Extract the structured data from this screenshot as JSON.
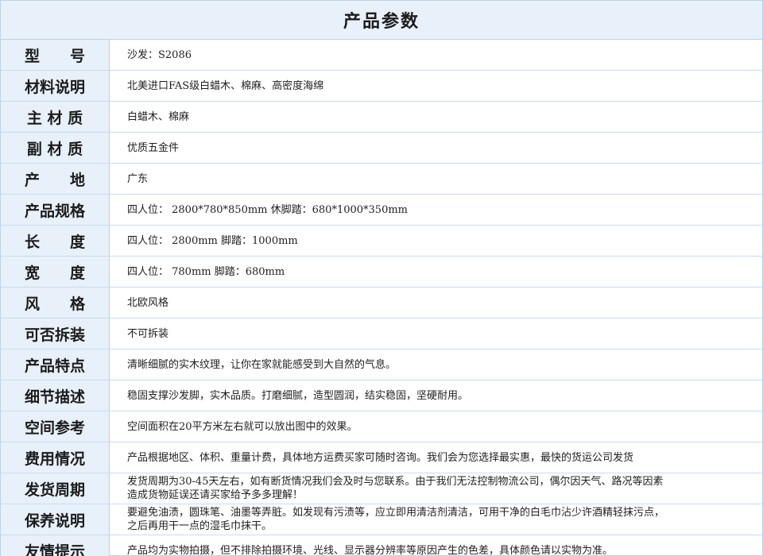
{
  "title": "产品参数",
  "rows": [
    {
      "label": "型　　号",
      "value": "沙发：S2086"
    },
    {
      "label": "材料说明",
      "value": "北美进口FAS级白蜡木、棉麻、高密度海绵"
    },
    {
      "label": "主 材 质",
      "value": "白蜡木、棉麻"
    },
    {
      "label": "副 材 质",
      "value": "优质五金件"
    },
    {
      "label": "产　　地",
      "value": "广东"
    },
    {
      "label": "产品规格",
      "value": "四人位： 2800*780*850mm  休脚踏：680*1000*350mm"
    },
    {
      "label": "长　　度",
      "value": "四人位： 2800mm  脚踏：1000mm"
    },
    {
      "label": "宽　　度",
      "value": "四人位： 780mm  脚踏：680mm"
    },
    {
      "label": "风　　格",
      "value": "北欧风格"
    },
    {
      "label": "可否拆装",
      "value": "不可拆装"
    },
    {
      "label": "产品特点",
      "value": "清晰细腻的实木纹理，让你在家就能感受到大自然的气息。"
    },
    {
      "label": "细节描述",
      "value": "稳固支撑沙发脚，实木品质。打磨细腻，造型圆润，结实稳固，坚硬耐用。"
    },
    {
      "label": "空间参考",
      "value": "空间面积在20平方米左右就可以放出图中的效果。"
    },
    {
      "label": "费用情况",
      "value": "产品根据地区、体积、重量计费，具体地方运费买家可随时咨询。我们会为您选择最实惠，最快的货运公司发货"
    },
    {
      "label": "发货周期",
      "value": "发货周期为30-45天左右，如有断货情况我们会及时与您联系。由于我们无法控制物流公司，偶尔因天气、路况等因素\n造成货物延误还请买家给予多多理解！"
    },
    {
      "label": "保养说明",
      "value": "要避免油渍，圆珠笔、油墨等弄脏。如发现有污渍等，应立即用清洁剂清洁，可用干净的白毛巾沾少许酒精轻抹污点，\n之后再用干一点的湿毛巾抹干。"
    },
    {
      "label": "友情提示",
      "value": "产品均为实物拍摄，但不排除拍摄环境、光线、显示器分辨率等原因产生的色差，具体颜色请以实物为准。"
    }
  ]
}
